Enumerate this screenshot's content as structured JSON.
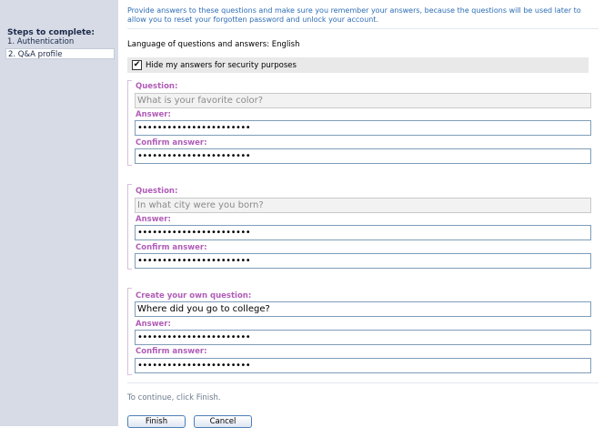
{
  "sidebar": {
    "heading": "Steps to complete:",
    "steps": [
      {
        "label": "1. Authentication"
      },
      {
        "label": "2. Q&A profile"
      }
    ]
  },
  "intro": "Provide answers to these questions and make sure you remember your answers, because the questions will be used later to allow you to reset your forgotten password and unlock your account.",
  "language_line": "Language of questions and answers: English",
  "hide_answers": {
    "label": "Hide my answers for security purposes",
    "checked": true,
    "mark": "✔"
  },
  "labels": {
    "question": "Question:",
    "answer": "Answer:",
    "confirm": "Confirm answer:",
    "own_question": "Create your own question:"
  },
  "qa": [
    {
      "question": "What is your favorite color?",
      "answer_masked": "•••••••••••••••••••••••",
      "confirm_masked": "•••••••••••••••••••••••"
    },
    {
      "question": "In what city were you born?",
      "answer_masked": "•••••••••••••••••••••••",
      "confirm_masked": "•••••••••••••••••••••••"
    },
    {
      "question": "Where did you go to college?",
      "answer_masked": "•••••••••••••••••••••••",
      "confirm_masked": "•••••••••••••••••••••••"
    }
  ],
  "footer": {
    "continue_text": "To continue, click Finish.",
    "finish_label": "Finish",
    "cancel_label": "Cancel"
  }
}
